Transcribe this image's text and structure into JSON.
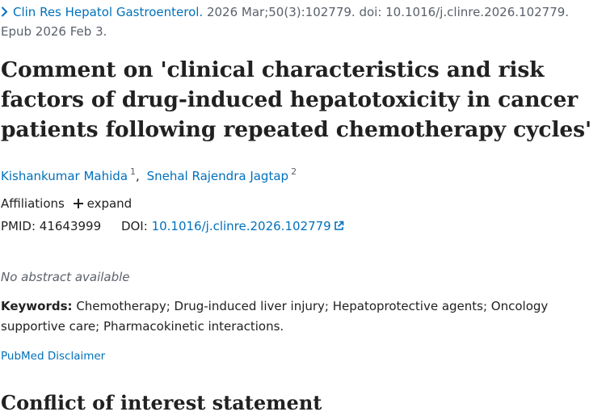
{
  "citation": {
    "journal": "Clin Res Hepatol Gastroenterol.",
    "details": "2026 Mar;50(3):102779. doi: 10.1016/j.clinre.2026.102779.",
    "epub": "Epub 2026 Feb 3."
  },
  "title": "Comment on 'clinical characteristics and risk factors of drug-induced hepatotoxicity in cancer patients following repeated chemotherapy cycles'",
  "authors": [
    {
      "name": "Kishankumar Mahida",
      "aff": "1"
    },
    {
      "name": "Snehal Rajendra Jagtap",
      "aff": "2"
    }
  ],
  "affiliations": {
    "label": "Affiliations",
    "expand": "expand"
  },
  "ids": {
    "pmid_label": "PMID:",
    "pmid": "41643999",
    "doi_label": "DOI:",
    "doi": "10.1016/j.clinre.2026.102779"
  },
  "abstract_note": "No abstract available",
  "keywords": {
    "label": "Keywords:",
    "text": "Chemotherapy; Drug-induced liver injury; Hepatoprotective agents; Oncology supportive care; Pharmacokinetic interactions."
  },
  "disclaimer": "PubMed Disclaimer",
  "coi_heading": "Conflict of interest statement",
  "colors": {
    "link": "#0071bc",
    "text": "#212121",
    "muted": "#5b616b"
  },
  "icons": {
    "journal_toggle": "chevron-right-icon",
    "doi_link": "external-link-icon",
    "affiliations_expand": "plus-icon"
  }
}
